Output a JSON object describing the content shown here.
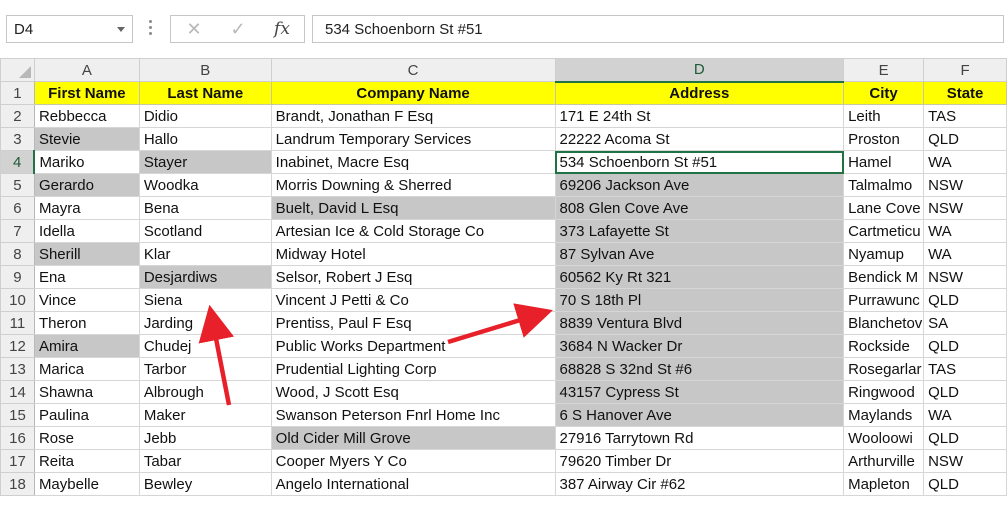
{
  "name_box": "D4",
  "formula_bar": {
    "cancel_glyph": "✕",
    "enter_glyph": "✓",
    "fx_label": "fx",
    "value": "534 Schoenborn St #51"
  },
  "columns": [
    "A",
    "B",
    "C",
    "D",
    "E",
    "F"
  ],
  "selected_column": "D",
  "selected_row": "4",
  "headers": [
    "First Name",
    "Last Name",
    "Company Name",
    "Address",
    "City",
    "State"
  ],
  "rows": [
    {
      "n": "2",
      "cells": [
        "Rebbecca",
        "Didio",
        "Brandt, Jonathan F Esq",
        "171 E 24th St",
        "Leith",
        "TAS"
      ]
    },
    {
      "n": "3",
      "cells": [
        "Stevie",
        "Hallo",
        "Landrum Temporary Services",
        "22222 Acoma St",
        "Proston",
        "QLD"
      ]
    },
    {
      "n": "4",
      "cells": [
        "Mariko",
        "Stayer",
        "Inabinet, Macre Esq",
        "534 Schoenborn St #51",
        "Hamel",
        "WA"
      ]
    },
    {
      "n": "5",
      "cells": [
        "Gerardo",
        "Woodka",
        "Morris Downing & Sherred",
        "69206 Jackson Ave",
        "Talmalmo",
        "NSW"
      ]
    },
    {
      "n": "6",
      "cells": [
        "Mayra",
        "Bena",
        "Buelt, David L Esq",
        "808 Glen Cove Ave",
        "Lane Cove",
        "NSW"
      ]
    },
    {
      "n": "7",
      "cells": [
        "Idella",
        "Scotland",
        "Artesian Ice & Cold Storage Co",
        "373 Lafayette St",
        "Cartmeticu",
        "WA"
      ]
    },
    {
      "n": "8",
      "cells": [
        "Sherill",
        "Klar",
        "Midway Hotel",
        "87 Sylvan Ave",
        "Nyamup",
        "WA"
      ]
    },
    {
      "n": "9",
      "cells": [
        "Ena",
        "Desjardiws",
        "Selsor, Robert J Esq",
        "60562 Ky Rt 321",
        "Bendick M",
        "NSW"
      ]
    },
    {
      "n": "10",
      "cells": [
        "Vince",
        "Siena",
        "Vincent J Petti & Co",
        "70 S 18th Pl",
        "Purrawunc",
        "QLD"
      ]
    },
    {
      "n": "11",
      "cells": [
        "Theron",
        "Jarding",
        "Prentiss, Paul F Esq",
        "8839 Ventura Blvd",
        "Blanchetov",
        "SA"
      ]
    },
    {
      "n": "12",
      "cells": [
        "Amira",
        "Chudej",
        "Public Works Department",
        "3684 N Wacker Dr",
        "Rockside",
        "QLD"
      ]
    },
    {
      "n": "13",
      "cells": [
        "Marica",
        "Tarbor",
        "Prudential Lighting Corp",
        "68828 S 32nd St #6",
        "Rosegarlar",
        "TAS"
      ]
    },
    {
      "n": "14",
      "cells": [
        "Shawna",
        "Albrough",
        "Wood, J Scott Esq",
        "43157 Cypress St",
        "Ringwood",
        "QLD"
      ]
    },
    {
      "n": "15",
      "cells": [
        "Paulina",
        "Maker",
        "Swanson Peterson Fnrl Home Inc",
        "6 S Hanover Ave",
        "Maylands",
        "WA"
      ]
    },
    {
      "n": "16",
      "cells": [
        "Rose",
        "Jebb",
        "Old Cider Mill Grove",
        "27916 Tarrytown Rd",
        "Wooloowi",
        "QLD"
      ]
    },
    {
      "n": "17",
      "cells": [
        "Reita",
        "Tabar",
        "Cooper Myers Y Co",
        "79620 Timber Dr",
        "Arthurville",
        "NSW"
      ]
    },
    {
      "n": "18",
      "cells": [
        "Maybelle",
        "Bewley",
        "Angelo International",
        "387 Airway Cir #62",
        "Mapleton",
        "QLD"
      ]
    }
  ],
  "highlighted_cells": [
    "A3",
    "A5",
    "A8",
    "A12",
    "B4",
    "B9",
    "C6",
    "C16",
    "D5",
    "D6",
    "D7",
    "D8",
    "D9",
    "D10",
    "D11",
    "D12",
    "D13",
    "D14",
    "D15"
  ],
  "active_cell": "D4",
  "colors": {
    "header_fill": "#ffff00",
    "highlight_fill": "#c7c7c7",
    "selection_green": "#217346",
    "arrow_red": "#e8202a"
  }
}
